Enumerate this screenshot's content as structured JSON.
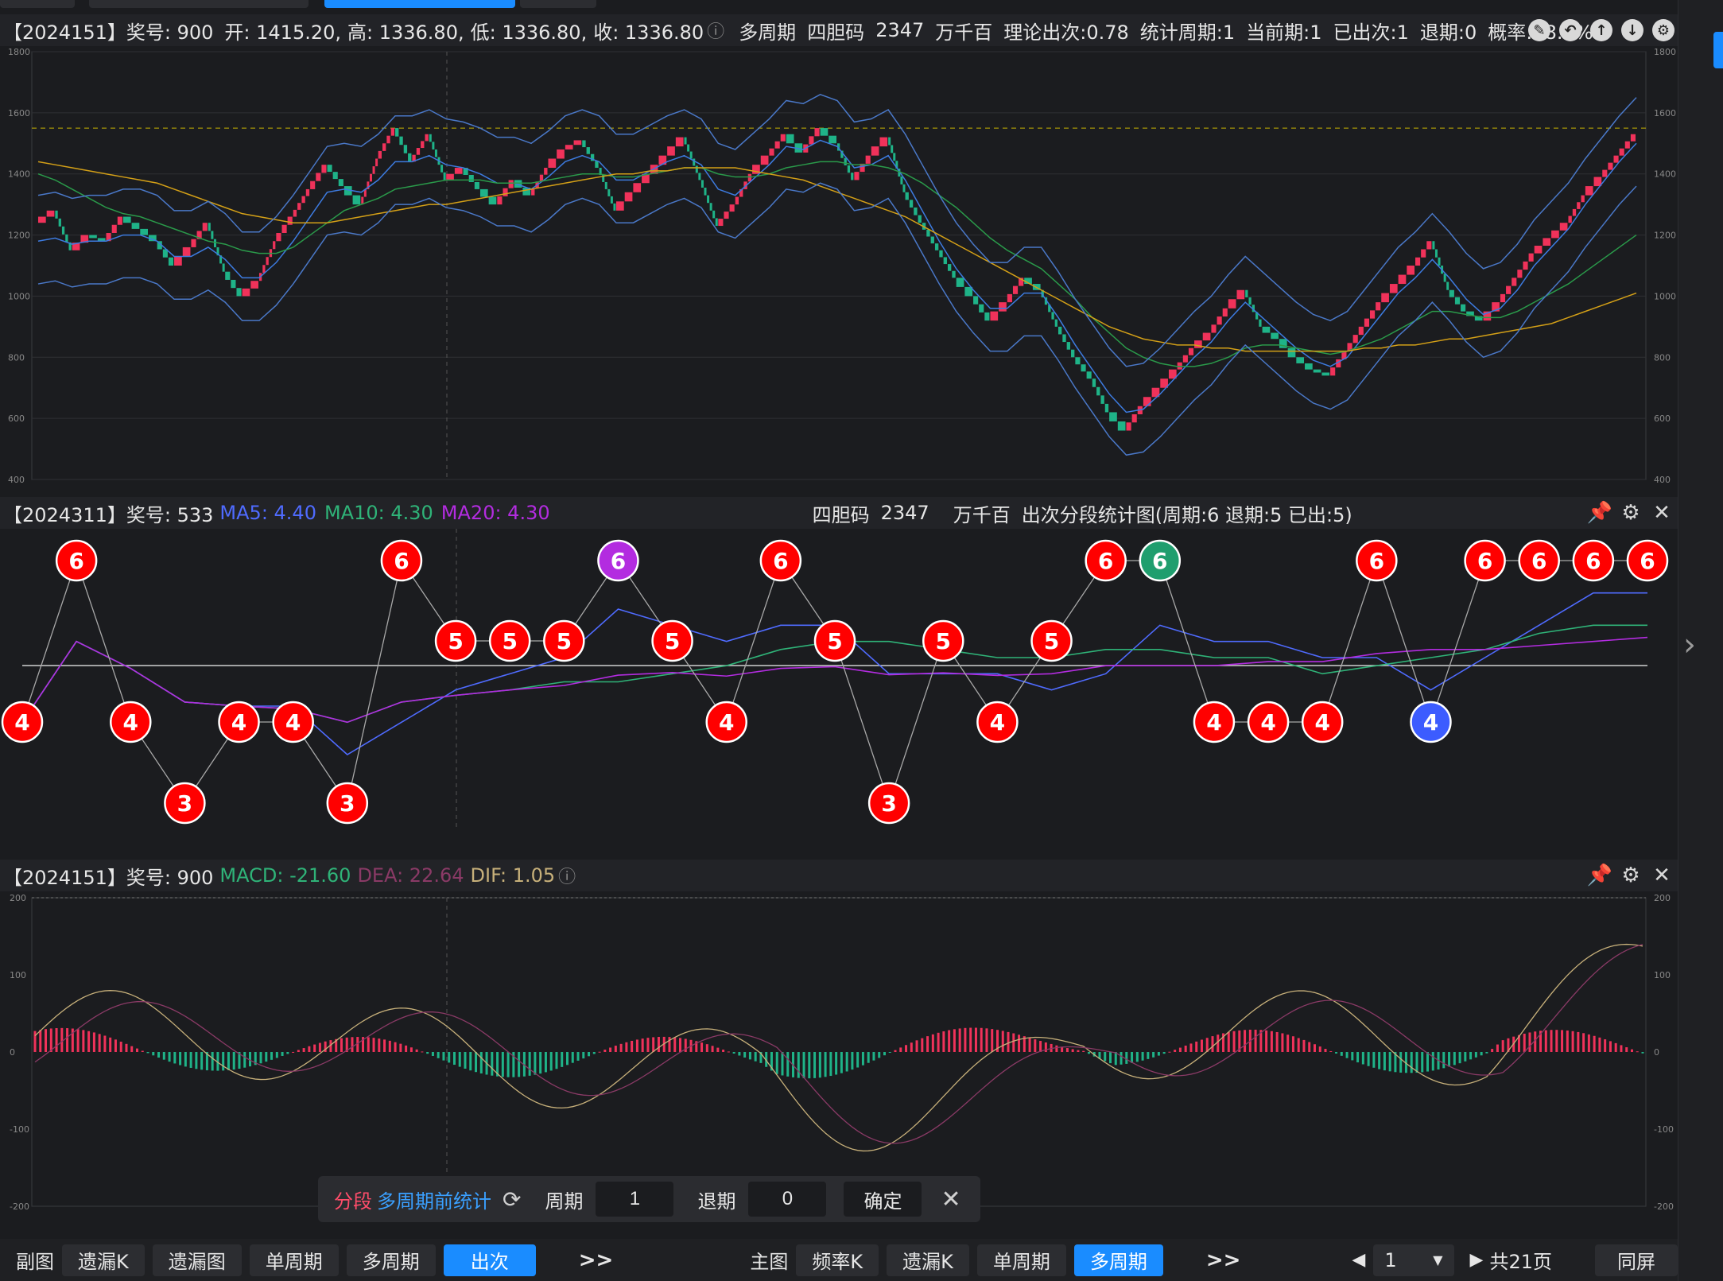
{
  "main_panel": {
    "header": {
      "issue": "【2024151】奖号: 900",
      "open": "开: 1415.20,",
      "high": "高: 1336.80,",
      "low": "低: 1336.80,",
      "close": "收: 1336.80",
      "mode": "多周期",
      "code_type": "四胆码",
      "code": "2347",
      "position": "万千百",
      "theory": "理论出次:0.78",
      "stat_period": "统计周期:1",
      "current_period": "当前期:1",
      "appeared": "已出次:1",
      "back_period": "退期:0",
      "probability": "概率:78.4%"
    },
    "y_ticks": [
      "1800",
      "1600",
      "1400",
      "1200",
      "1000",
      "800",
      "600",
      "400"
    ],
    "icons": [
      "edit-icon",
      "undo-icon",
      "up-arrow-icon",
      "down-arrow-icon",
      "settings-icon"
    ]
  },
  "sub_panel": {
    "header": {
      "issue": "【2024311】奖号: 533",
      "ma5": "MA5: 4.40",
      "ma10": "MA10: 4.30",
      "ma20": "MA20: 4.30",
      "code_type": "四胆码",
      "code": "2347",
      "position": "万千百",
      "title": "出次分段统计图(周期:6  退期:5  已出:5)"
    },
    "colors": {
      "ma5": "#4f6bff",
      "ma10": "#2fb378",
      "ma20": "#b32ce0"
    }
  },
  "macd_panel": {
    "header": {
      "issue": "【2024151】奖号: 900",
      "macd": "MACD: -21.60",
      "dea": "DEA: 22.64",
      "dif": "DIF: 1.05"
    },
    "colors": {
      "macd": "#2fb378",
      "dea": "#8a3a66",
      "dif": "#c7b07a"
    },
    "y_ticks": [
      "200",
      "100",
      "0",
      "-100",
      "-200"
    ]
  },
  "popup": {
    "segment_label": "分段",
    "mode_label": "多周期前统计",
    "period_label": "周期",
    "period_value": "1",
    "back_label": "退期",
    "back_value": "0",
    "confirm_label": "确定"
  },
  "bottom_bar": {
    "sub_label": "副图",
    "sub_buttons": [
      "遗漏K",
      "遗漏图",
      "单周期",
      "多周期",
      "出次"
    ],
    "sub_active": "出次",
    "more1": ">>",
    "main_label": "主图",
    "main_buttons": [
      "频率K",
      "遗漏K",
      "单周期",
      "多周期"
    ],
    "main_active": "多周期",
    "more2": ">>",
    "page_value": "1",
    "total_pages": "共21页",
    "sync_label": "同屏"
  },
  "chart_data": [
    {
      "type": "line",
      "name": "candles",
      "ylim": [
        400,
        1800
      ],
      "grid": true,
      "reference_line": 1550,
      "close_values": [
        1240,
        1280,
        1150,
        1200,
        1180,
        1260,
        1220,
        1180,
        1100,
        1160,
        1240,
        1080,
        1000,
        1050,
        1180,
        1260,
        1350,
        1430,
        1360,
        1300,
        1450,
        1550,
        1440,
        1530,
        1380,
        1420,
        1350,
        1300,
        1380,
        1330,
        1420,
        1480,
        1510,
        1420,
        1280,
        1340,
        1400,
        1460,
        1520,
        1380,
        1230,
        1300,
        1400,
        1460,
        1530,
        1470,
        1550,
        1500,
        1380,
        1460,
        1520,
        1340,
        1240,
        1150,
        1060,
        1000,
        920,
        980,
        1060,
        1020,
        900,
        800,
        730,
        620,
        560,
        640,
        700,
        760,
        830,
        880,
        960,
        1020,
        900,
        860,
        800,
        760,
        740,
        820,
        900,
        980,
        1040,
        1100,
        1180,
        1020,
        950,
        920,
        980,
        1060,
        1140,
        1190,
        1240,
        1330,
        1390,
        1460,
        1530
      ],
      "ma_lines": {
        "ma_short": [
          1180,
          1190,
          1170,
          1180,
          1180,
          1200,
          1200,
          1180,
          1130,
          1130,
          1160,
          1120,
          1060,
          1060,
          1110,
          1180,
          1260,
          1340,
          1350,
          1340,
          1380,
          1440,
          1440,
          1460,
          1430,
          1420,
          1400,
          1370,
          1370,
          1350,
          1390,
          1440,
          1460,
          1440,
          1380,
          1380,
          1410,
          1440,
          1460,
          1430,
          1350,
          1330,
          1380,
          1430,
          1490,
          1480,
          1510,
          1490,
          1420,
          1430,
          1460,
          1380,
          1280,
          1180,
          1090,
          1020,
          960,
          960,
          1010,
          1010,
          930,
          840,
          760,
          680,
          620,
          630,
          680,
          740,
          800,
          850,
          920,
          980,
          930,
          880,
          830,
          790,
          770,
          800,
          870,
          940,
          1010,
          1060,
          1120,
          1060,
          990,
          940,
          960,
          1020,
          1100,
          1160,
          1220,
          1300,
          1370,
          1440,
          1500
        ],
        "ma_mid": [
          1400,
          1380,
          1350,
          1320,
          1290,
          1270,
          1260,
          1240,
          1220,
          1200,
          1180,
          1170,
          1150,
          1140,
          1140,
          1160,
          1200,
          1240,
          1280,
          1300,
          1320,
          1350,
          1360,
          1370,
          1380,
          1380,
          1380,
          1370,
          1370,
          1370,
          1380,
          1390,
          1400,
          1400,
          1390,
          1390,
          1400,
          1410,
          1420,
          1420,
          1400,
          1390,
          1390,
          1400,
          1420,
          1430,
          1440,
          1440,
          1430,
          1430,
          1420,
          1400,
          1370,
          1330,
          1290,
          1240,
          1190,
          1150,
          1120,
          1090,
          1040,
          990,
          930,
          880,
          830,
          800,
          780,
          770,
          770,
          780,
          800,
          830,
          840,
          840,
          830,
          820,
          810,
          820,
          840,
          860,
          890,
          920,
          950,
          950,
          940,
          930,
          930,
          950,
          980,
          1010,
          1040,
          1080,
          1120,
          1160,
          1200
        ],
        "ma_long": [
          1440,
          1430,
          1420,
          1410,
          1400,
          1390,
          1380,
          1370,
          1350,
          1330,
          1310,
          1290,
          1270,
          1260,
          1250,
          1240,
          1240,
          1240,
          1250,
          1260,
          1270,
          1280,
          1290,
          1300,
          1300,
          1310,
          1320,
          1330,
          1340,
          1350,
          1360,
          1370,
          1380,
          1390,
          1400,
          1400,
          1410,
          1410,
          1420,
          1420,
          1420,
          1420,
          1410,
          1400,
          1390,
          1380,
          1360,
          1340,
          1320,
          1300,
          1280,
          1260,
          1230,
          1200,
          1170,
          1140,
          1110,
          1080,
          1050,
          1020,
          990,
          960,
          930,
          900,
          880,
          860,
          850,
          840,
          840,
          830,
          830,
          820,
          820,
          820,
          820,
          820,
          820,
          820,
          830,
          830,
          840,
          840,
          850,
          860,
          860,
          870,
          880,
          890,
          900,
          910,
          930,
          950,
          970,
          990,
          1010
        ]
      }
    },
    {
      "type": "line",
      "name": "出次分段统计图",
      "values": [
        4,
        6,
        4,
        3,
        4,
        4,
        3,
        6,
        5,
        5,
        5,
        6,
        5,
        4,
        6,
        5,
        3,
        5,
        4,
        5,
        6,
        6,
        4,
        4,
        4,
        6,
        4,
        6,
        6,
        6,
        6
      ],
      "highlight": {
        "11": "#b32ce0",
        "21": "#1f9e6e",
        "26": "#3c5cff"
      },
      "default_color": "#ff0000"
    },
    {
      "type": "bar",
      "name": "MACD",
      "ylim": [
        -200,
        200
      ]
    }
  ]
}
